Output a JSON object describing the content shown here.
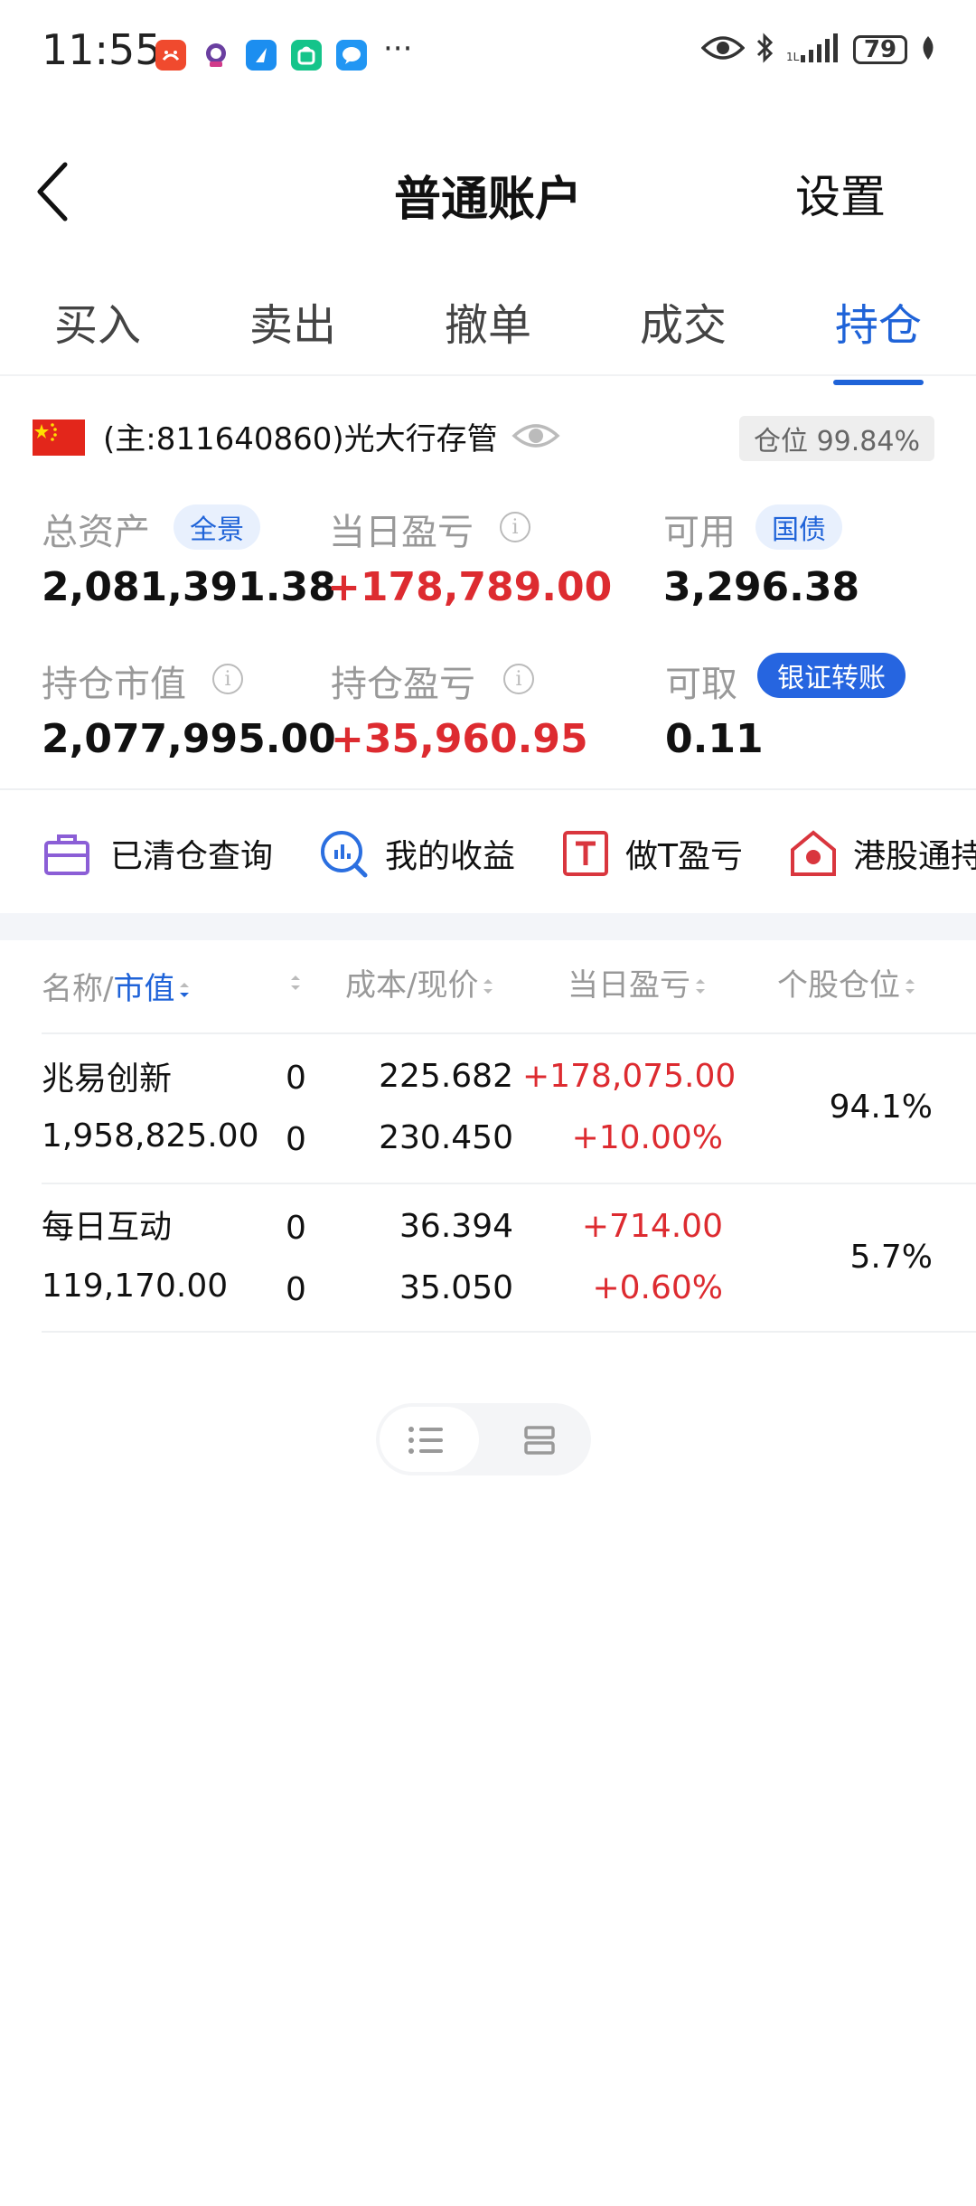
{
  "status_bar": {
    "time": "11:55",
    "overflow": "···",
    "battery": "79"
  },
  "header": {
    "title": "普通账户",
    "settings": "设置"
  },
  "tabs": [
    {
      "label": "买入",
      "active": false
    },
    {
      "label": "卖出",
      "active": false
    },
    {
      "label": "撤单",
      "active": false
    },
    {
      "label": "成交",
      "active": false
    },
    {
      "label": "持仓",
      "active": true
    }
  ],
  "account": {
    "name": "(主:811640860)光大行存管",
    "position_ratio": "仓位 99.84%"
  },
  "metrics": {
    "total_assets_label": "总资产",
    "total_assets_pill": "全景",
    "total_assets": "2,081,391.38",
    "daily_pl_label": "当日盈亏",
    "daily_pl": "+178,789.00",
    "available_label": "可用",
    "available_pill": "国债",
    "available": "3,296.38",
    "holding_value_label": "持仓市值",
    "holding_value": "2,077,995.00",
    "holding_pl_label": "持仓盈亏",
    "holding_pl": "+35,960.95",
    "withdrawable_label": "可取",
    "transfer_button": "银证转账",
    "withdrawable": "0.11",
    "info_glyph": "i"
  },
  "quick_links": [
    {
      "label": "已清仓查询",
      "icon": "briefcase-icon"
    },
    {
      "label": "我的收益",
      "icon": "bar-search-icon"
    },
    {
      "label": "做T盈亏",
      "icon": "t-box-icon"
    },
    {
      "label": "港股通持",
      "icon": "hk-house-icon"
    }
  ],
  "table": {
    "header_name": "名称/",
    "header_value": "市值",
    "header_cost": "成本/现价",
    "header_pl": "当日盈亏",
    "header_weight": "个股仓位",
    "rows": [
      {
        "name": "兆易创新",
        "value": "1,958,825.00",
        "qty_a": "0",
        "qty_b": "0",
        "cost": "225.682",
        "price": "230.450",
        "pl": "+178,075.00",
        "pl_pct": "+10.00%",
        "weight": "94.1%"
      },
      {
        "name": "每日互动",
        "value": "119,170.00",
        "qty_a": "0",
        "qty_b": "0",
        "cost": "36.394",
        "price": "35.050",
        "pl": "+714.00",
        "pl_pct": "+0.60%",
        "weight": "5.7%"
      }
    ]
  },
  "colors": {
    "accent": "#1f63d8",
    "up_red": "#dd2b30",
    "muted": "#999999"
  }
}
